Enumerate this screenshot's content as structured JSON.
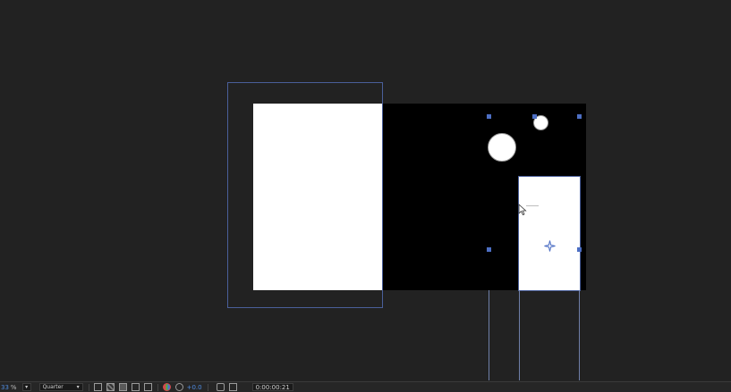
{
  "toolbar": {
    "zoom_value": "33",
    "zoom_unit": "%",
    "resolution": "Quarter",
    "exposure": "+0.0",
    "timecode": "0:00:00:21"
  },
  "icons": {
    "zoom_dropdown": "chevron-down-icon",
    "resolution_dropdown": "chevron-down-icon",
    "toolbar_icons": [
      "fit-to-frame-icon",
      "transparency-grid-icon",
      "region-of-interest-icon",
      "mask-visibility-icon",
      "guides-icon",
      "color-channels-icon",
      "color-management-icon",
      "snapshot-camera-icon",
      "show-snapshot-icon"
    ],
    "anchor_point": "anchor-point-icon",
    "cursor": "mouse-pointer-icon"
  },
  "colors": {
    "panel_bg": "#222222",
    "composition_bg": "#000000",
    "shape_fill": "#ffffff",
    "selection_accent": "#4d6fc4",
    "value_accent": "#4f8be0"
  }
}
